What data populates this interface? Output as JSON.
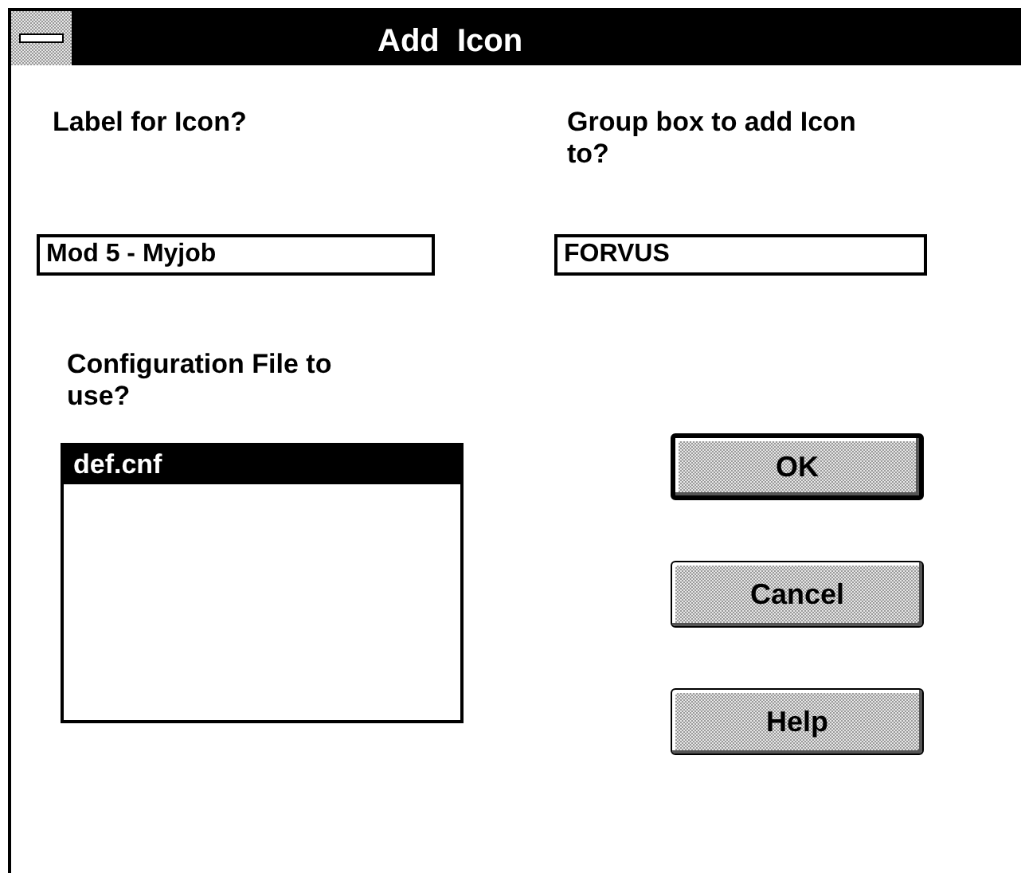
{
  "window": {
    "title": "Add  Icon"
  },
  "label_field": {
    "label": "Label for Icon?",
    "value": "Mod 5 - Myjob"
  },
  "group_field": {
    "label": "Group box to add Icon to?",
    "value": "FORVUS"
  },
  "config_list": {
    "label": "Configuration File to use?",
    "items": [
      {
        "text": "def.cnf",
        "selected": true
      }
    ]
  },
  "buttons": [
    {
      "label": "OK",
      "default": true
    },
    {
      "label": "Cancel",
      "default": false
    },
    {
      "label": "Help",
      "default": false
    }
  ]
}
